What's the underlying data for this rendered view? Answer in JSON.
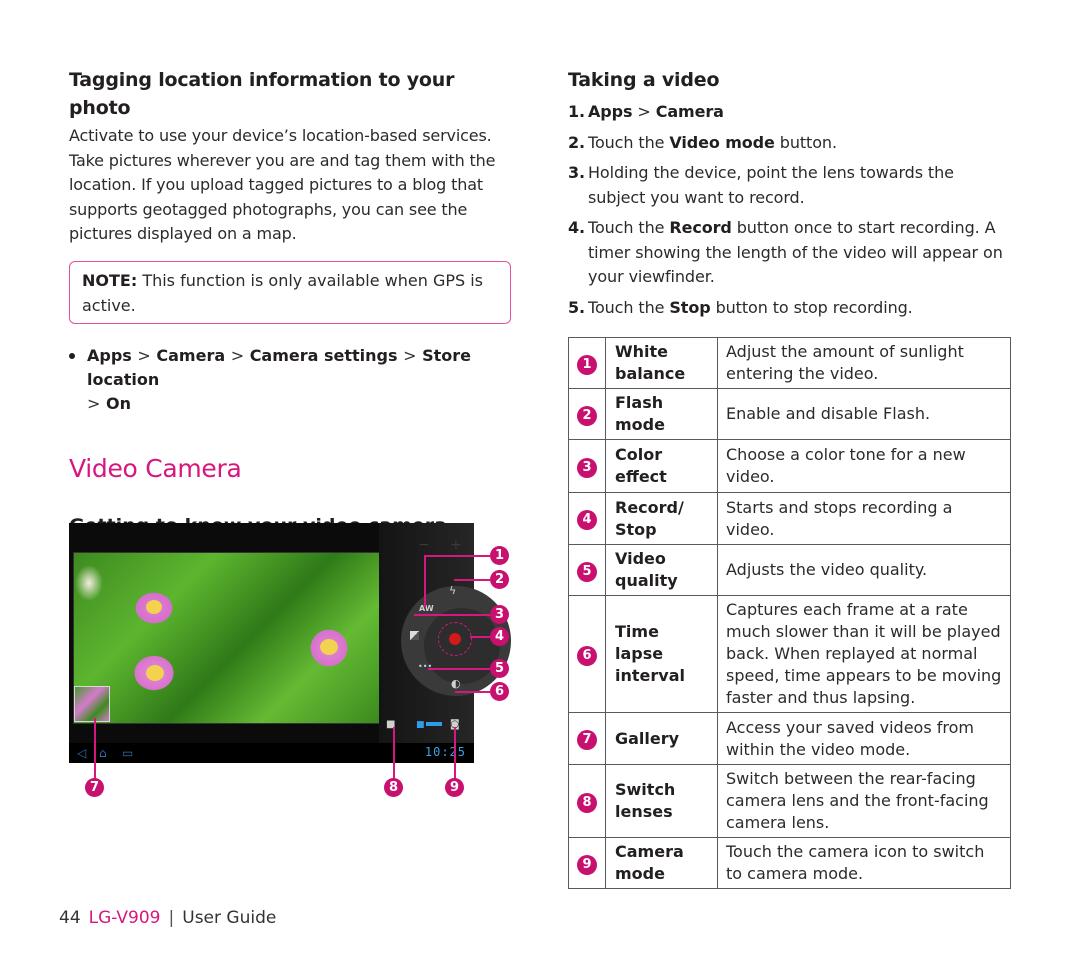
{
  "left": {
    "tagging_heading": "Tagging location information to your photo",
    "tagging_body": "Activate to use your device’s location-based services. Take pictures wherever you are and tag them with the location. If you upload tagged pictures to a blog that supports geotagged photographs, you can see the pictures displayed on a map.",
    "note_label": "NOTE:",
    "note_text": " This function is only available when GPS is active.",
    "path": [
      {
        "label": "Apps"
      },
      {
        "label": "Camera"
      },
      {
        "label": "Camera settings"
      },
      {
        "label": "Store location"
      },
      {
        "label": "On"
      }
    ],
    "path_separator": ">",
    "section_title": "Video Camera",
    "viewfinder_heading": "Getting to know your video camera view finder"
  },
  "figure": {
    "zoom_out": "−",
    "zoom_in": "+",
    "white_balance_icon": "AW",
    "quality_icon": "•••",
    "clock": "10:25",
    "callouts": [
      "1",
      "2",
      "3",
      "4",
      "5",
      "6",
      "7",
      "8",
      "9"
    ]
  },
  "right": {
    "heading": "Taking a video",
    "steps": [
      {
        "num": "1.",
        "a": "Apps",
        "sep": " > ",
        "b": "Camera"
      },
      {
        "num": "2.",
        "pre": "Touch the ",
        "bold": "Video mode",
        "post": " button."
      },
      {
        "num": "3.",
        "text": "Holding the device, point the lens towards the subject you want to record."
      },
      {
        "num": "4.",
        "pre": "Touch the ",
        "bold": "Record",
        "post": " button once to start recording. A timer showing the length of the video will appear on your viewfinder."
      },
      {
        "num": "5.",
        "pre": "Touch the ",
        "bold": "Stop",
        "post": " button to stop recording."
      }
    ],
    "table": [
      {
        "num": "1",
        "name": "White balance",
        "desc": "Adjust the amount of sunlight entering the video."
      },
      {
        "num": "2",
        "name": "Flash mode",
        "desc": "Enable and disable Flash."
      },
      {
        "num": "3",
        "name": "Color effect",
        "desc": "Choose a color tone for a new video."
      },
      {
        "num": "4",
        "name": "Record/ Stop",
        "desc": "Starts and stops recording a video."
      },
      {
        "num": "5",
        "name": "Video quality",
        "desc": "Adjusts the video quality."
      },
      {
        "num": "6",
        "name": "Time lapse interval",
        "desc": "Captures each frame at a rate much slower than it will be played back. When replayed at normal speed, time appears to be moving faster and thus lapsing."
      },
      {
        "num": "7",
        "name": "Gallery",
        "desc": "Access your saved videos from within the video mode."
      },
      {
        "num": "8",
        "name": "Switch lenses",
        "desc": "Switch between the rear-facing camera lens and the front-facing camera lens."
      },
      {
        "num": "9",
        "name": "Camera mode",
        "desc": "Touch the camera icon to switch to camera mode."
      }
    ]
  },
  "footer": {
    "page": "44",
    "model": "LG-V909",
    "separator": "|",
    "guide": "User Guide"
  },
  "colors": {
    "accent": "#d6177f",
    "badge": "#c8106f",
    "text": "#231f20"
  }
}
